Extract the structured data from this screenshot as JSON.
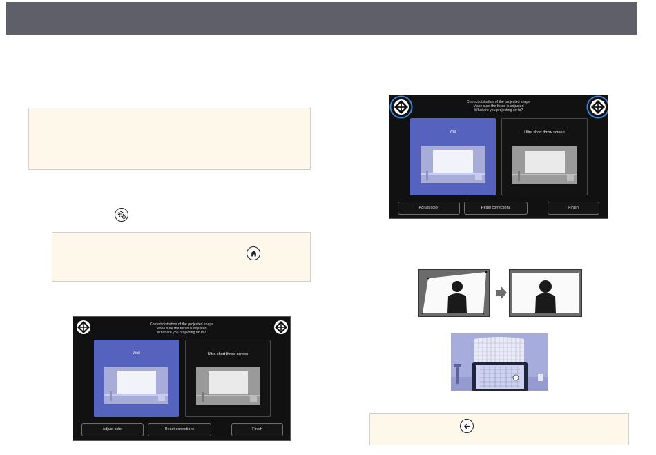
{
  "colors": {
    "header": "#5f5f69",
    "note_bg": "#fdf8ea",
    "note_border": "#cfcfcf",
    "screen_bg": "#111111",
    "wall_card": "#5562be",
    "highlight_ring": "#3f86d6"
  },
  "icons": {
    "settings": "gear-icon",
    "home": "home-icon",
    "back": "back-arrow-icon",
    "arrow": "right-arrow-icon",
    "target": "calibration-target-icon"
  },
  "screen": {
    "line1": "Correct distortion of the projected shape",
    "line2": "Make sure the focus is adjusted",
    "line3": "What are you projecting on to?",
    "wall_label": "Wall",
    "ust_label": "Ultra short throw screen",
    "adjust_color": "Adjust color",
    "reset_corrections": "Reset corrections",
    "finish": "Finish"
  }
}
